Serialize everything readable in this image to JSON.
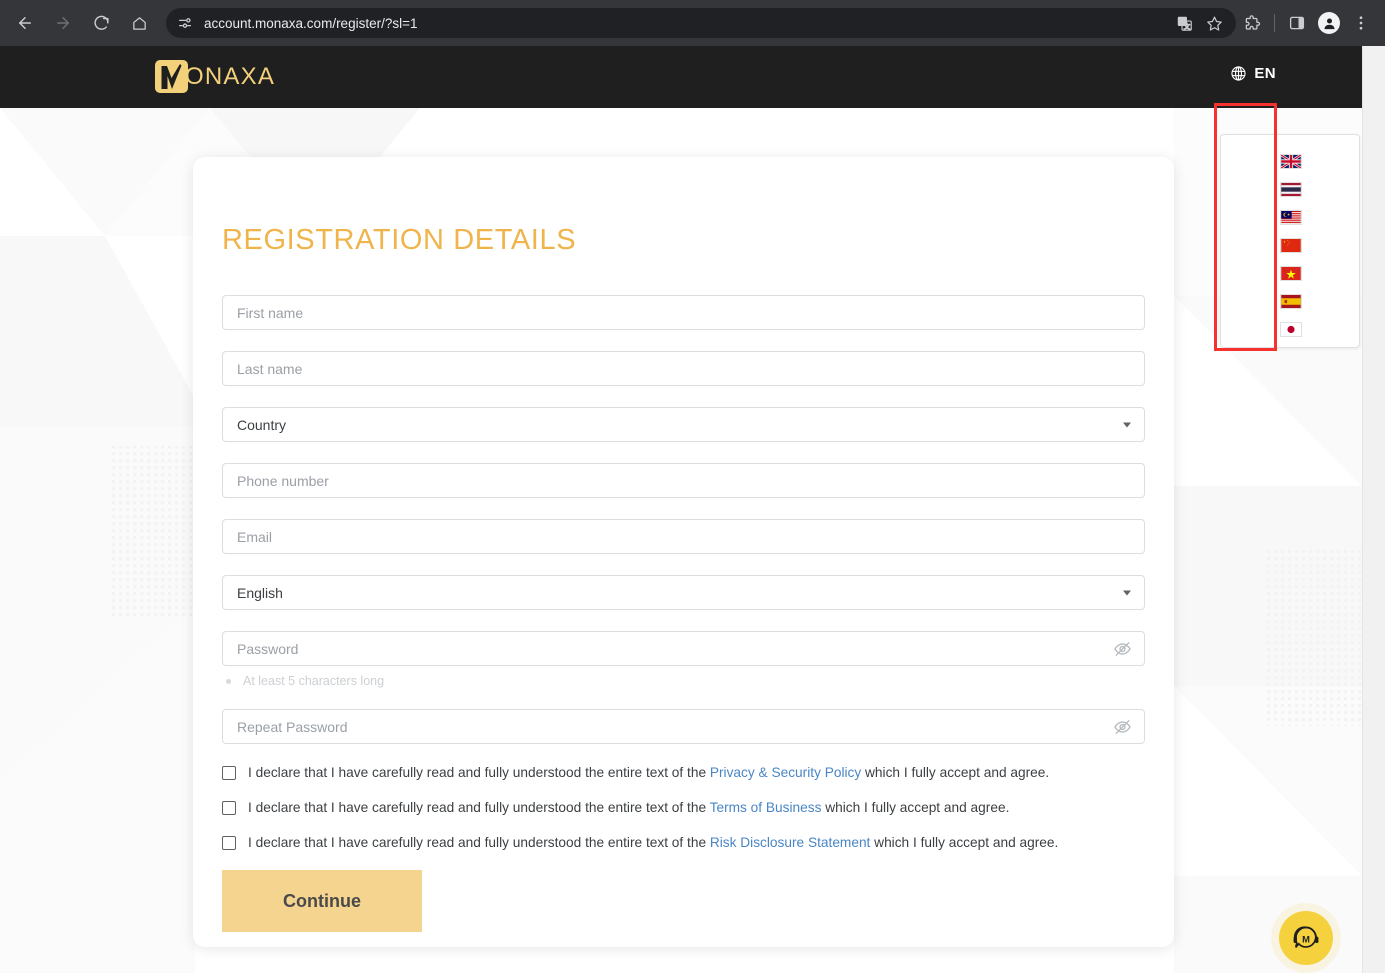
{
  "browser": {
    "back_label": "back-navigation",
    "forward_label": "forward-navigation",
    "reload_label": "reload",
    "home_label": "home",
    "url": "account.monaxa.com/register/?sl=1",
    "site_settings_icon": "tune-icon",
    "translate_icon": "translate-icon",
    "bookmark_icon": "star-outline-icon",
    "extensions_icon": "puzzle-piece-icon",
    "side_panel_icon": "side-panel-icon",
    "profile_icon": "account-avatar-icon",
    "menu_icon": "three-dot-menu-icon"
  },
  "site_header": {
    "logo_text": "ONAXA",
    "logo_mark_letter": "M",
    "language": {
      "globe_icon": "globe-icon",
      "code": "EN",
      "options": [
        {
          "name": "English",
          "flag": "united-kingdom"
        },
        {
          "name": "Thai",
          "flag": "thailand"
        },
        {
          "name": "Malay",
          "flag": "malaysia"
        },
        {
          "name": "Chinese",
          "flag": "china"
        },
        {
          "name": "Vietnamese",
          "flag": "vietnam"
        },
        {
          "name": "Spanish",
          "flag": "spain"
        },
        {
          "name": "Japanese",
          "flag": "japan"
        }
      ]
    }
  },
  "form": {
    "title": "REGISTRATION DETAILS",
    "fields": [
      {
        "key": "first_name",
        "placeholder": "First name",
        "value": "",
        "type": "text"
      },
      {
        "key": "last_name",
        "placeholder": "Last name",
        "value": "",
        "type": "text"
      },
      {
        "key": "country",
        "placeholder": "Country",
        "value": "Country",
        "type": "select"
      },
      {
        "key": "phone_number",
        "placeholder": "Phone number",
        "value": "",
        "type": "text"
      },
      {
        "key": "email",
        "placeholder": "Email",
        "value": "",
        "type": "text"
      },
      {
        "key": "language",
        "placeholder": "English",
        "value": "English",
        "type": "select"
      },
      {
        "key": "password",
        "placeholder": "Password",
        "value": "",
        "type": "password"
      },
      {
        "key": "repeat_password",
        "placeholder": "Repeat Password",
        "value": "",
        "type": "password"
      }
    ],
    "password_hint": "At least 5 characters long",
    "password_toggle_icon": "eye-off-icon",
    "declarations": [
      {
        "prefix": "I declare that I have carefully read and fully understood the entire text of the ",
        "link": "Privacy & Security Policy",
        "suffix": " which I fully accept and agree.",
        "checked": false
      },
      {
        "prefix": "I declare that I have carefully read and fully understood the entire text of the ",
        "link": "Terms of Business",
        "suffix": " which I fully accept and agree.",
        "checked": false
      },
      {
        "prefix": "I declare that I have carefully read and fully understood the entire text of the ",
        "link": "Risk Disclosure Statement",
        "suffix": " which I fully accept and agree.",
        "checked": false
      }
    ],
    "submit_label": "Continue"
  },
  "support": {
    "icon": "headset-chat-icon",
    "badge_letter": "M"
  },
  "colors": {
    "brand_gold": "#efb44c",
    "logo_gold": "#f3d07a",
    "button_gold": "#f5d490",
    "link_blue": "#4a86c5",
    "header_dark": "#1f1f1f",
    "annotation_red": "#f5322e",
    "widget_yellow": "#f5d13e"
  }
}
